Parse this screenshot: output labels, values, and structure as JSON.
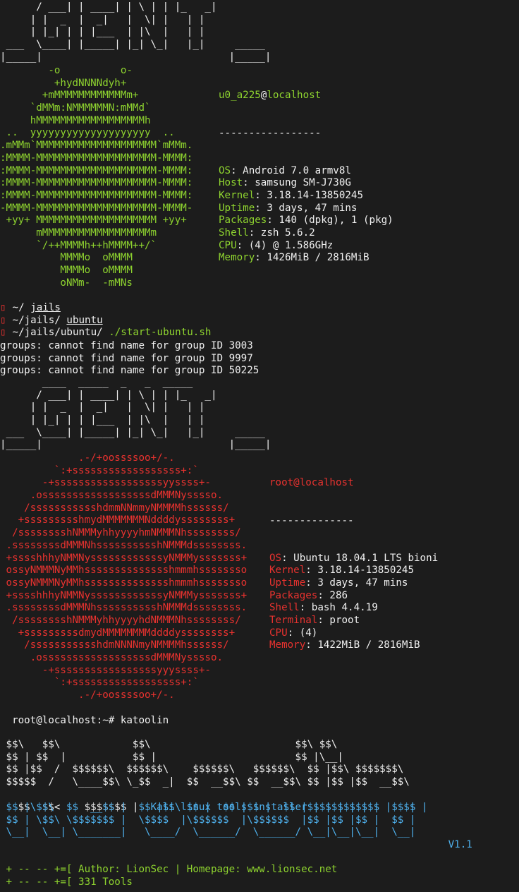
{
  "neofetch1": {
    "banner": [
      "      / ___| | ____| | \\ | | |_   _|",
      "     | |  _  |  _|   |  \\| |   | |",
      "     | |_| | | |___  | |\\  |   | |",
      " ___  \\____| |_____| |_| \\_|   |_|     _____",
      "|_____|                               |_____|"
    ],
    "logo": [
      "        -o          o-",
      "         +hydNNNNdyh+",
      "       +mMMMMMMMMMMMMm+",
      "     `dMMm:NMMMMMMN:mMMd`",
      "     hMMMMMMMMMMMMMMMMMMh",
      " ..  yyyyyyyyyyyyyyyyyyyy  ..",
      ".mMMm`MMMMMMMMMMMMMMMMMMMM`mMMm.",
      ":MMMM-MMMMMMMMMMMMMMMMMMMM-MMMM:",
      ":MMMM-MMMMMMMMMMMMMMMMMMMM-MMMM:",
      ":MMMM-MMMMMMMMMMMMMMMMMMMM-MMMM:",
      ":MMMM-MMMMMMMMMMMMMMMMMMMM-MMMM:",
      "-MMMM-MMMMMMMMMMMMMMMMMMMM-MMMM-",
      " +yy+ MMMMMMMMMMMMMMMMMMMM +yy+",
      "      mMMMMMMMMMMMMMMMMMMm",
      "      `/++MMMMh++hMMMM++/`",
      "          MMMMo  oMMMM",
      "          MMMMo  oMMMM",
      "          oNMm-  -mMNs"
    ],
    "user": "u0_a225",
    "at": "@",
    "host": "localhost",
    "separator": "-----------------",
    "fields": [
      {
        "key": "OS",
        "value": ": Android 7.0 armv8l"
      },
      {
        "key": "Host",
        "value": ": samsung SM-J730G"
      },
      {
        "key": "Kernel",
        "value": ": 3.18.14-13850245"
      },
      {
        "key": "Uptime",
        "value": ": 3 days, 47 mins"
      },
      {
        "key": "Packages",
        "value": ": 140 (dpkg), 1 (pkg)"
      },
      {
        "key": "Shell",
        "value": ": zsh 5.6.2"
      },
      {
        "key": "CPU",
        "value": ": (4) @ 1.586GHz"
      },
      {
        "key": "Memory",
        "value": ": 1426MiB / 2816MiB"
      }
    ]
  },
  "shell_history": [
    {
      "prompt": " ~/ ",
      "cmd": "jails"
    },
    {
      "prompt": " ~/jails/ ",
      "cmd": "ubuntu"
    },
    {
      "prompt": " ~/jails/ubuntu/ ",
      "cmd": "./start-ubuntu.sh"
    }
  ],
  "group_errors": [
    "groups: cannot find name for group ID 3003",
    "groups: cannot find name for group ID 9997",
    "groups: cannot find name for group ID 50225"
  ],
  "neofetch2": {
    "banner": [
      "       ____  _____  _   _  _____",
      "      / ___| | ____| | \\ | | |_   _|",
      "     | |  _  |  _|   |  \\| |   | |",
      "     | |_| | | |___  | |\\  |   | |",
      " ___  \\____| |_____| |_| \\_|   |_|     _____",
      "|_____|                               |_____|"
    ],
    "logo": [
      "             .-/+oossssoo+/-.",
      "         `:+ssssssssssssssssss+:`",
      "       -+ssssssssssssssssssyyssss+-",
      "     .ossssssssssssssssssdMMMNysssso.",
      "    /ssssssssssshdmmNNmmyNMMMMhssssss/",
      "   +ssssssssshmydMMMMMMMNddddyssssssss+",
      "  /sssssssshNMMMyhhyyyyhmNMMMNhssssssss/",
      " .ssssssssdMMMNhsssssssssshNMMMdssssssss.",
      " +sssshhhyNMMNyssssssssssssyNMMMysssssss+",
      " ossyNMMMNyMMhsssssssssssssshmmmhssssssso",
      " ossyNMMMNyMMhsssssssssssssshmmmhssssssso",
      " +sssshhhyNMMNyssssssssssssyNMMMysssssss+",
      " .ssssssssdMMMNhsssssssssshNMMMdssssssss.",
      "  /sssssssshNMMMyhhyyyyhdNMMMNhssssssss/",
      "   +sssssssssdmydMMMMMMMMddddyssssssss+",
      "    /ssssssssssshdmNNNNmyNMMMMhssssss/",
      "     .ossssssssssssssssssdMMMNysssso.",
      "       -+sssssssssssssssssyyyssss+-",
      "         `:+ssssssssssssssssss+:`",
      "             .-/+oossssoo+/-."
    ],
    "user": "root",
    "at": "@",
    "host": "localhost",
    "separator": "--------------",
    "fields": [
      {
        "key": "OS",
        "value": ": Ubuntu 18.04.1 LTS bioni"
      },
      {
        "key": "Kernel",
        "value": ": 3.18.14-13850245"
      },
      {
        "key": "Uptime",
        "value": ": 3 days, 47 mins"
      },
      {
        "key": "Packages",
        "value": ": 286"
      },
      {
        "key": "Shell",
        "value": ": bash 4.4.19"
      },
      {
        "key": "Terminal",
        "value": ": proot"
      },
      {
        "key": "CPU",
        "value": ": (4)"
      },
      {
        "key": "Memory",
        "value": ": 1422MiB / 2816MiB"
      }
    ]
  },
  "root_prompt": "root@localhost:~# ",
  "root_cmd": "katoolin",
  "katoolin": {
    "banner_white": [
      " $$\\   $$\\            $$\\                        $$\\ $$\\",
      " $$ | $$  |           $$ |                       $$ |\\__|",
      " $$ |$$  /  $$$$$$\\  $$$$$$\\    $$$$$$\\   $$$$$$\\  $$ |$$\\ $$$$$$$\\",
      " $$$$$  /   \\____$$\\ \\_$$  _|  $$  __$$\\ $$  __$$\\ $$ |$$ |$$  __$$\\"
    ],
    "line5_white": " $$  $$<    $$$$$$$ |  ",
    "line5_blue": "Kali linux tools installer |$$ |$$ |$$ |  $$ |",
    "banner_blue": [
      " $$ |\\$$\\  $$  __$$ |  $$ |$$\\ $$ |  $$ |$$ |  $$ |$$ |$$ |$$ |  $$ |",
      " $$ | \\$$\\ \\$$$$$$$ |  \\$$$$  |\\$$$$$$  |\\$$$$$$  |$$ |$$ |$$ |  $$ |",
      " \\__|  \\__| \\_______|   \\____/  \\______/  \\______/ \\__|\\__|\\__|  \\__|"
    ],
    "version": " V1.1",
    "author_line": " + -- -- +=[ Author: LionSec | Homepage: www.lionsec.net",
    "tools_line": " + -- -- +=[ 331 Tools"
  },
  "colors": {
    "background": "#1c1c1c",
    "green": "#8ed32f",
    "red": "#e8322f",
    "blue": "#4fb2ef",
    "text": "#ececec"
  }
}
